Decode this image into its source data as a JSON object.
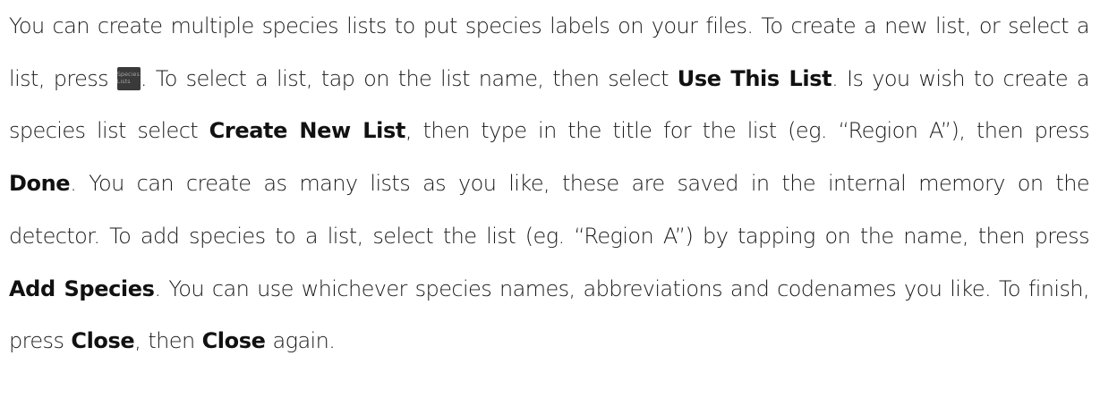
{
  "paragraph": {
    "s1": "You can create multiple species lists to put species labels on your files. To create a new list, or select a list, press",
    "button_label_line1": "Species",
    "button_label_line2": "Lists",
    "s2": ". To select a list, tap on the list name, then select",
    "bold_use_list": "Use This List",
    "s3": ". Is you wish to create a species list select",
    "bold_create_list": "Create New List",
    "s4": ", then type in the title for the list (eg. “Region A”), then press",
    "bold_done": "Done",
    "s5": ". You can create as many lists as you like, these are saved in the internal memory on the detector. To add species to a list, select the list (eg. “Region A”) by tapping on the name, then press",
    "bold_add_species": "Add Species",
    "s6": ". You can use whichever species names, abbreviations and codenames you like. To finish, press",
    "bold_close_1": "Close",
    "s7": ", then",
    "bold_close_2": "Close",
    "s8": "again."
  }
}
